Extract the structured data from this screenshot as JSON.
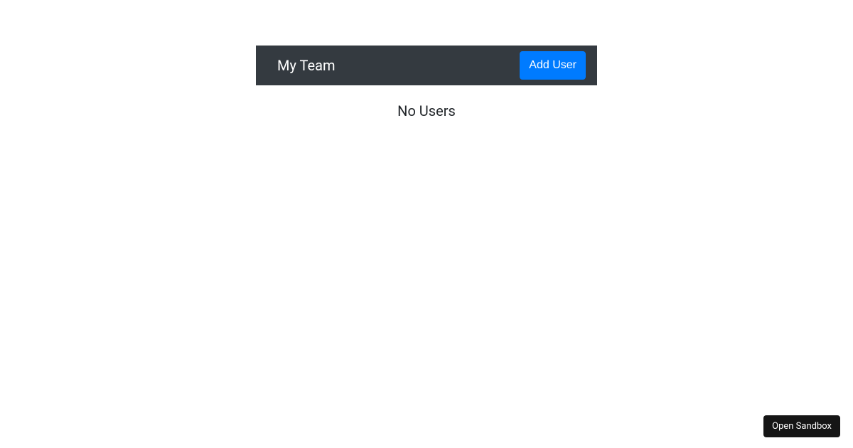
{
  "navbar": {
    "brand": "My Team",
    "add_user_label": "Add User"
  },
  "main": {
    "empty_message": "No Users"
  },
  "footer": {
    "sandbox_label": "Open Sandbox"
  }
}
